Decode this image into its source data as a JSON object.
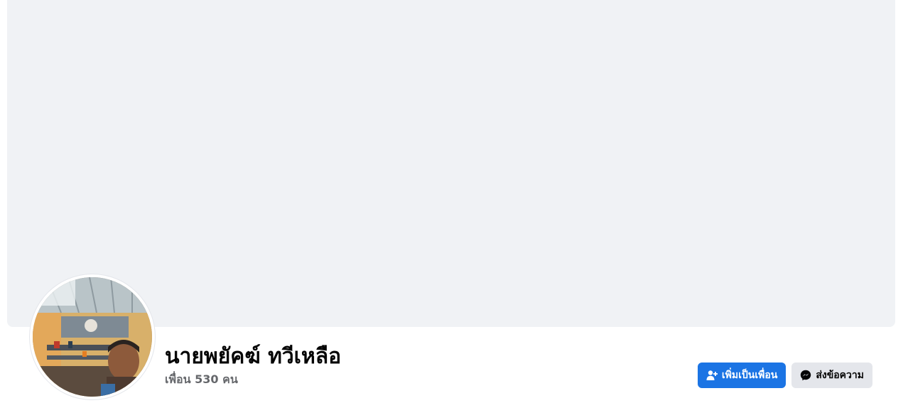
{
  "profile": {
    "name": "นายพยัคฆ์ ทวีเหลือ",
    "friends_prefix": "เพื่อน",
    "friends_count": "530",
    "friends_suffix": "คน"
  },
  "actions": {
    "add_friend_label": "เพิ่มเป็นเพื่อน",
    "message_label": "ส่งข้อความ"
  },
  "icons": {
    "add_friend": "add-person-icon",
    "message": "messenger-icon"
  },
  "colors": {
    "primary_button": "#1b74e4",
    "secondary_button": "#e4e6eb",
    "cover_background": "#f0f2f5"
  }
}
